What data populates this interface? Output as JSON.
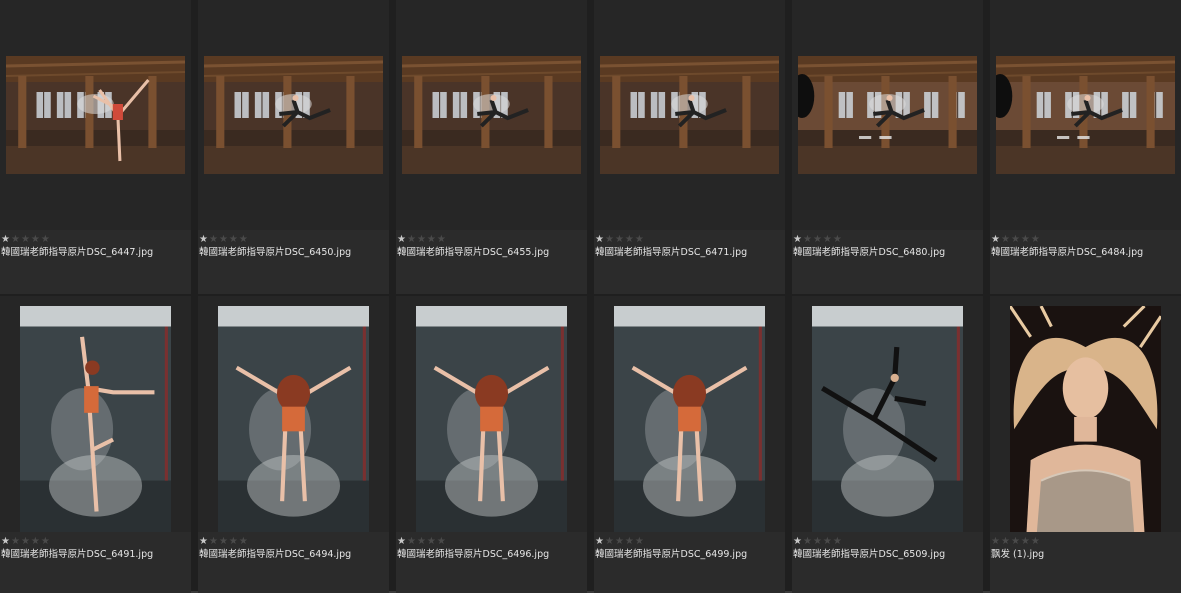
{
  "gallery": {
    "items": [
      {
        "filename": "韓國瑞老師指导原片DSC_6447.jpg",
        "rating": 1,
        "orientation": "landscape",
        "scene": "dancer-arabesque-loft"
      },
      {
        "filename": "韓國瑞老師指导原片DSC_6450.jpg",
        "rating": 1,
        "orientation": "landscape",
        "scene": "dancer-leap-loft"
      },
      {
        "filename": "韓國瑞老師指导原片DSC_6455.jpg",
        "rating": 1,
        "orientation": "landscape",
        "scene": "dancer-leap-loft"
      },
      {
        "filename": "韓國瑞老師指导原片DSC_6471.jpg",
        "rating": 1,
        "orientation": "landscape",
        "scene": "dancer-leap-loft"
      },
      {
        "filename": "韓國瑞老師指导原片DSC_6480.jpg",
        "rating": 1,
        "orientation": "landscape",
        "scene": "dancer-split-loft-wide"
      },
      {
        "filename": "韓國瑞老師指导原片DSC_6484.jpg",
        "rating": 1,
        "orientation": "landscape",
        "scene": "dancer-split-loft-wide"
      },
      {
        "filename": "韓國瑞老師指导原片DSC_6491.jpg",
        "rating": 1,
        "orientation": "portrait",
        "scene": "dancer-powder-studio"
      },
      {
        "filename": "韓國瑞老師指导原片DSC_6494.jpg",
        "rating": 1,
        "orientation": "portrait",
        "scene": "dancer-back-jump-studio"
      },
      {
        "filename": "韓國瑞老師指导原片DSC_6496.jpg",
        "rating": 1,
        "orientation": "portrait",
        "scene": "dancer-back-jump-studio"
      },
      {
        "filename": "韓國瑞老師指导原片DSC_6499.jpg",
        "rating": 1,
        "orientation": "portrait",
        "scene": "dancer-back-jump-studio"
      },
      {
        "filename": "韓國瑞老師指导原片DSC_6509.jpg",
        "rating": 1,
        "orientation": "portrait",
        "scene": "dancer-split-studio"
      },
      {
        "filename": "飘发 (1).jpg",
        "rating": 0,
        "orientation": "portrait",
        "scene": "woman-flowing-hair"
      }
    ]
  },
  "colors": {
    "background": "#1f1f1f",
    "cell": "#2b2b2b",
    "star_on": "#c8c8c8",
    "star_off": "#4a4a4a",
    "text": "#e6e6e6"
  },
  "icons": {
    "star": "star-icon"
  }
}
